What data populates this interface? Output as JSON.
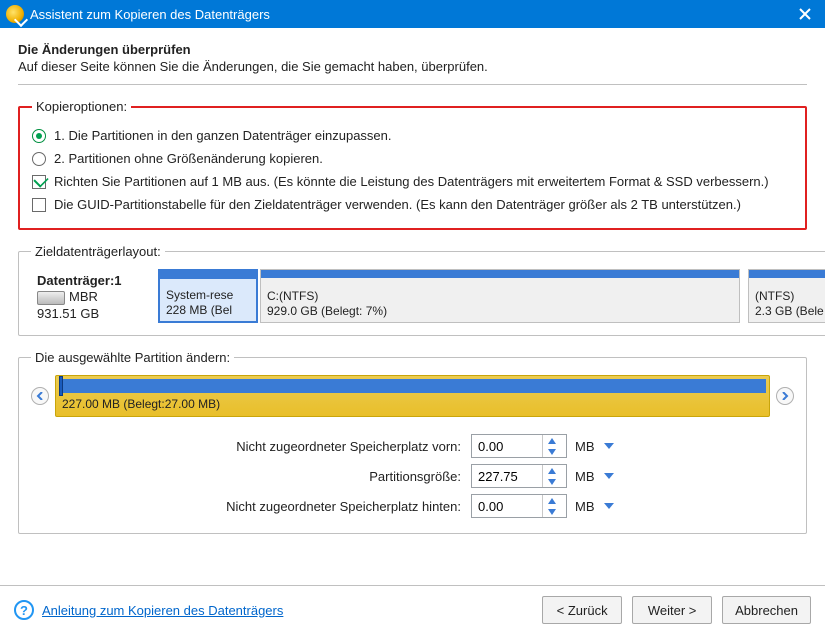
{
  "titlebar": {
    "title": "Assistent zum Kopieren des Datenträgers"
  },
  "header": {
    "title": "Die Änderungen überprüfen",
    "subtitle": "Auf dieser Seite können Sie die Änderungen, die Sie gemacht haben, überprüfen."
  },
  "options": {
    "legend": "Kopieroptionen:",
    "opt1": "1. Die Partitionen in den ganzen Datenträger einzupassen.",
    "opt2": "2. Partitionen ohne Größenänderung kopieren.",
    "chk1": "Richten Sie Partitionen auf 1 MB aus. (Es könnte die Leistung des Datenträgers mit erweitertem Format & SSD verbessern.)",
    "chk2": "Die GUID-Partitionstabelle für den Zieldatenträger verwenden. (Es kann den Datenträger größer als 2 TB unterstützen.)",
    "radio_selected": 1,
    "chk1_checked": true,
    "chk2_checked": false
  },
  "layout": {
    "legend": "Zieldatenträgerlayout:",
    "disk": {
      "name": "Datenträger:1",
      "type": "MBR",
      "size": "931.51 GB"
    },
    "parts": [
      {
        "label": "System-rese",
        "size": "228 MB (Bel"
      },
      {
        "label": "C:(NTFS)",
        "size": "929.0 GB (Belegt: 7%)"
      },
      {
        "label": "(NTFS)",
        "size": "2.3 GB (Bele"
      }
    ]
  },
  "editor": {
    "legend": "Die ausgewählte Partition ändern:",
    "bar_label": "227.00 MB (Belegt:27.00 MB)",
    "rows": {
      "before": {
        "label": "Nicht zugeordneter Speicherplatz vorn:",
        "value": "0.00",
        "unit": "MB"
      },
      "size": {
        "label": "Partitionsgröße:",
        "value": "227.75",
        "unit": "MB"
      },
      "after": {
        "label": "Nicht zugeordneter Speicherplatz hinten:",
        "value": "0.00",
        "unit": "MB"
      }
    }
  },
  "footer": {
    "help": "Anleitung zum Kopieren des Datenträgers",
    "back": "< Zurück",
    "next": "Weiter >",
    "cancel": "Abbrechen"
  }
}
